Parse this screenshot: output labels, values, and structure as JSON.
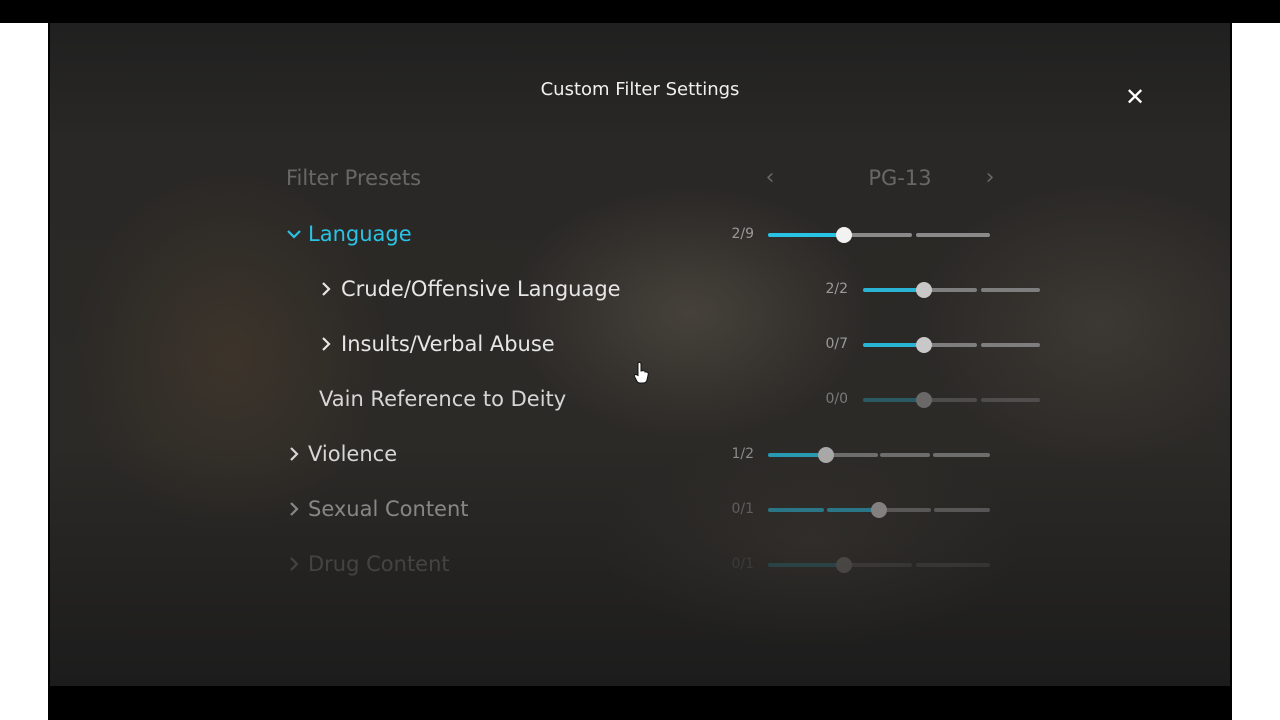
{
  "title": "Custom Filter Settings",
  "close_icon": "close-icon",
  "presets": {
    "label": "Filter Presets",
    "value": "PG-13"
  },
  "colors": {
    "accent": "#29c3e6",
    "track": "#8a8a8a",
    "knob": "#d9d9d9"
  },
  "rows": [
    {
      "label": "Language",
      "count": "2/9",
      "level": 0.34,
      "expanded": true,
      "icon": "chevron-down-icon"
    },
    {
      "label": "Crude/Offensive Language",
      "count": "2/2",
      "level": 0.34,
      "icon": "chevron-right-icon"
    },
    {
      "label": "Insults/Verbal Abuse",
      "count": "0/7",
      "level": 0.34,
      "icon": "chevron-right-icon"
    },
    {
      "label": "Vain Reference to Deity",
      "count": "0/0",
      "level": 0.34
    },
    {
      "label": "Violence",
      "count": "1/2",
      "level": 0.26,
      "icon": "chevron-right-icon"
    },
    {
      "label": "Sexual Content",
      "count": "0/1",
      "level": 0.5,
      "icon": "chevron-right-icon"
    },
    {
      "label": "Drug Content",
      "count": "0/1",
      "level": 0.34,
      "icon": "chevron-right-icon"
    }
  ]
}
